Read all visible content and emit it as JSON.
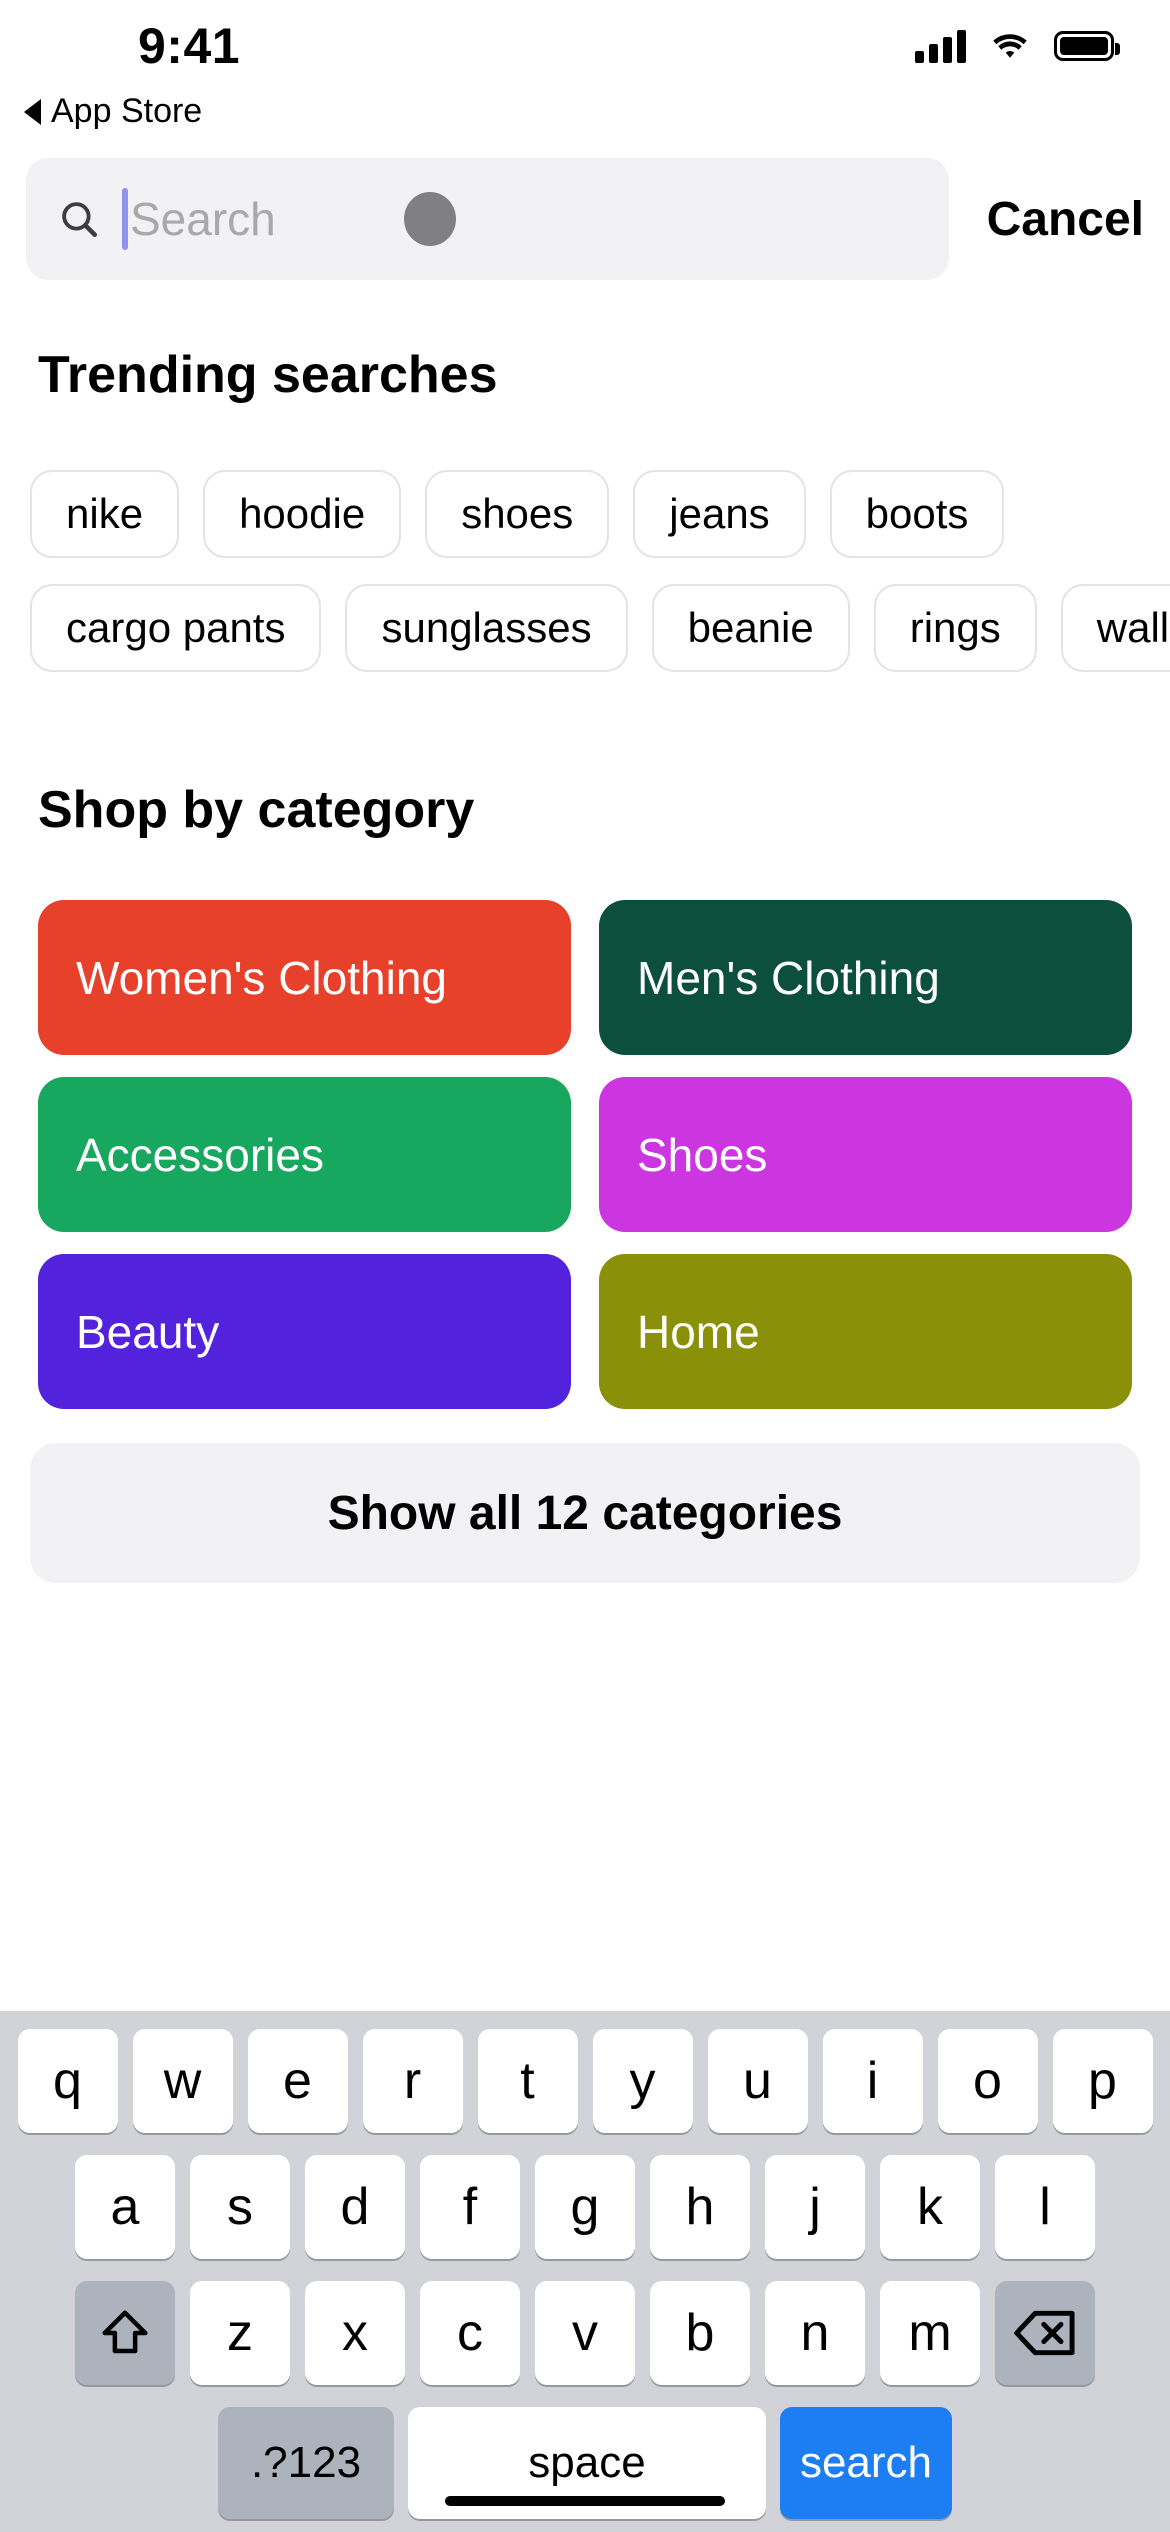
{
  "status_bar": {
    "time": "9:41",
    "cellular_icon": "signal-bars-icon",
    "wifi_icon": "wifi-icon",
    "battery_icon": "battery-full-icon"
  },
  "back_link": {
    "label": "App Store",
    "icon": "back-triangle-icon"
  },
  "search": {
    "placeholder": "Search",
    "value": "",
    "icon": "search-icon",
    "cancel_label": "Cancel"
  },
  "trending": {
    "title": "Trending searches",
    "rows": [
      [
        "nike",
        "hoodie",
        "shoes",
        "jeans",
        "boots"
      ],
      [
        "cargo pants",
        "sunglasses",
        "beanie",
        "rings",
        "wallets"
      ]
    ]
  },
  "categories": {
    "title": "Shop by category",
    "tiles": [
      {
        "label": "Women's Clothing",
        "color": "#E8412B"
      },
      {
        "label": "Men's Clothing",
        "color": "#0C4F3C"
      },
      {
        "label": "Accessories",
        "color": "#17A75E"
      },
      {
        "label": "Shoes",
        "color": "#CC36E0"
      },
      {
        "label": "Beauty",
        "color": "#5222DD"
      },
      {
        "label": "Home",
        "color": "#8A9108"
      }
    ],
    "show_all_label": "Show all 12 categories"
  },
  "keyboard": {
    "row1": [
      "q",
      "w",
      "e",
      "r",
      "t",
      "y",
      "u",
      "i",
      "o",
      "p"
    ],
    "row2": [
      "a",
      "s",
      "d",
      "f",
      "g",
      "h",
      "j",
      "k",
      "l"
    ],
    "row3": [
      "z",
      "x",
      "c",
      "v",
      "b",
      "n",
      "m"
    ],
    "shift_icon": "shift-arrow-icon",
    "delete_icon": "backspace-icon",
    "numbers_label": ".?123",
    "space_label": "space",
    "search_label": "search"
  }
}
